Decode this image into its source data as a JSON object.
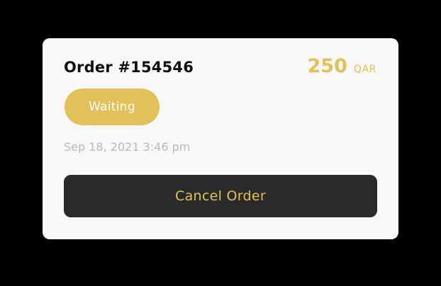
{
  "order": {
    "title": "Order #154546",
    "amount": "250",
    "currency": "QAR",
    "status": "Waiting",
    "timestamp": "Sep 18, 2021 3:46 pm",
    "cancel_label": "Cancel Order"
  },
  "colors": {
    "accent": "#e2c05a",
    "card_background": "#f8f8f8",
    "button_background": "#2a2a2a",
    "page_background": "#000000"
  }
}
